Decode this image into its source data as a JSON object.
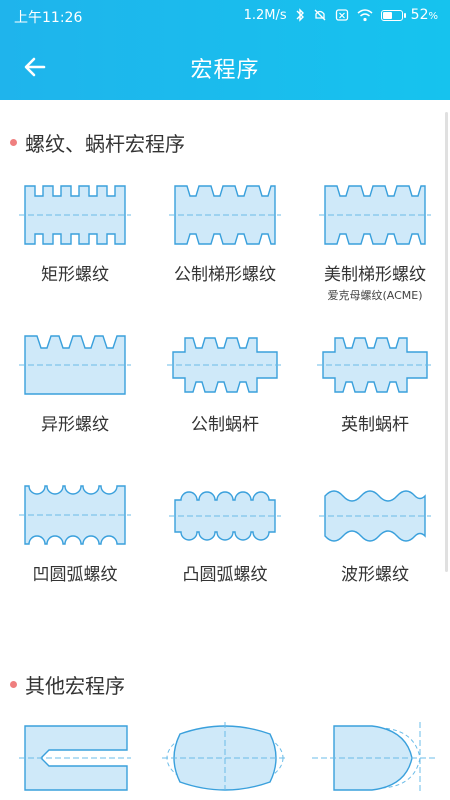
{
  "status_bar": {
    "time": "上午11:26",
    "speed": "1.2M/s",
    "battery": "52",
    "battery_level": 0.52,
    "icons": [
      "bluetooth-icon",
      "mute-icon",
      "sim-icon",
      "wifi-icon",
      "battery-icon"
    ]
  },
  "header": {
    "title": "宏程序",
    "back_icon": "arrow-left-icon"
  },
  "sections": [
    {
      "title": "螺纹、蜗杆宏程序",
      "items": [
        {
          "label": "矩形螺纹",
          "sub": ""
        },
        {
          "label": "公制梯形螺纹",
          "sub": ""
        },
        {
          "label": "美制梯形螺纹",
          "sub": "爱克母螺纹(ACME)"
        },
        {
          "label": "异形螺纹",
          "sub": ""
        },
        {
          "label": "公制蜗杆",
          "sub": ""
        },
        {
          "label": "英制蜗杆",
          "sub": ""
        },
        {
          "label": "凹圆弧螺纹",
          "sub": ""
        },
        {
          "label": "凸圆弧螺纹",
          "sub": ""
        },
        {
          "label": "波形螺纹",
          "sub": ""
        }
      ]
    },
    {
      "title": "其他宏程序",
      "items": [
        {
          "label": "",
          "sub": ""
        },
        {
          "label": "",
          "sub": ""
        },
        {
          "label": "",
          "sub": ""
        }
      ]
    }
  ],
  "colors": {
    "header": "#1fb4ec",
    "shape_fill": "#cfe9f9",
    "shape_stroke": "#3aa0dc",
    "dot": "#ef7f7f"
  }
}
